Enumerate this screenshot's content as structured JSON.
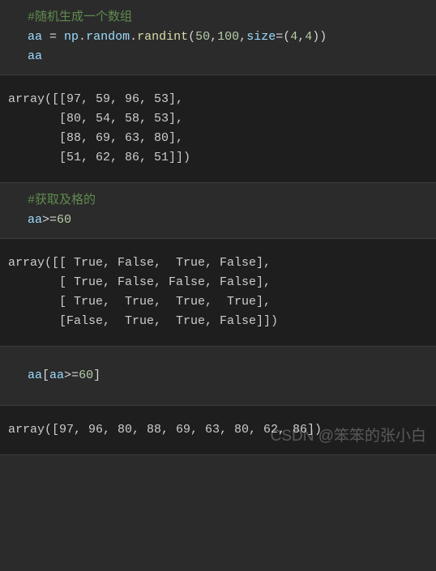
{
  "cells": {
    "c1": {
      "comment": "#随机生成一个数组",
      "line2": {
        "var": "aa",
        "eq": " = ",
        "mod1": "np",
        "dot1": ".",
        "mod2": "random",
        "dot2": ".",
        "func": "randint",
        "open": "(",
        "n1": "50",
        "c1": ",",
        "n2": "100",
        "c2": ",",
        "kw": "size",
        "eq2": "=",
        "open2": "(",
        "n3": "4",
        "c3": ",",
        "n4": "4",
        "close2": ")",
        "close": ")"
      },
      "line3": "aa"
    },
    "o1": "array([[97, 59, 96, 53],\n       [80, 54, 58, 53],\n       [88, 69, 63, 80],\n       [51, 62, 86, 51]])",
    "c2": {
      "comment": "#获取及格的",
      "line2": {
        "var": "aa",
        "op": ">=",
        "n": "60"
      }
    },
    "o2": "array([[ True, False,  True, False],\n       [ True, False, False, False],\n       [ True,  True,  True,  True],\n       [False,  True,  True, False]])",
    "c3": {
      "var": "aa",
      "open": "[",
      "var2": "aa",
      "op": ">=",
      "n": "60",
      "close": "]"
    },
    "o3": "array([97, 96, 80, 88, 69, 63, 80, 62, 86])"
  },
  "watermark": "CSDN @笨笨的张小白",
  "chart_data": {
    "type": "table",
    "note": "Jupyter notebook cells: numpy randint demo and boolean indexing",
    "array_aa": [
      [
        97,
        59,
        96,
        53
      ],
      [
        80,
        54,
        58,
        53
      ],
      [
        88,
        69,
        63,
        80
      ],
      [
        51,
        62,
        86,
        51
      ]
    ],
    "mask_ge_60": [
      [
        true,
        false,
        true,
        false
      ],
      [
        true,
        false,
        false,
        false
      ],
      [
        true,
        true,
        true,
        true
      ],
      [
        false,
        true,
        true,
        false
      ]
    ],
    "filtered": [
      97,
      96,
      80,
      88,
      69,
      63,
      80,
      62,
      86
    ]
  }
}
